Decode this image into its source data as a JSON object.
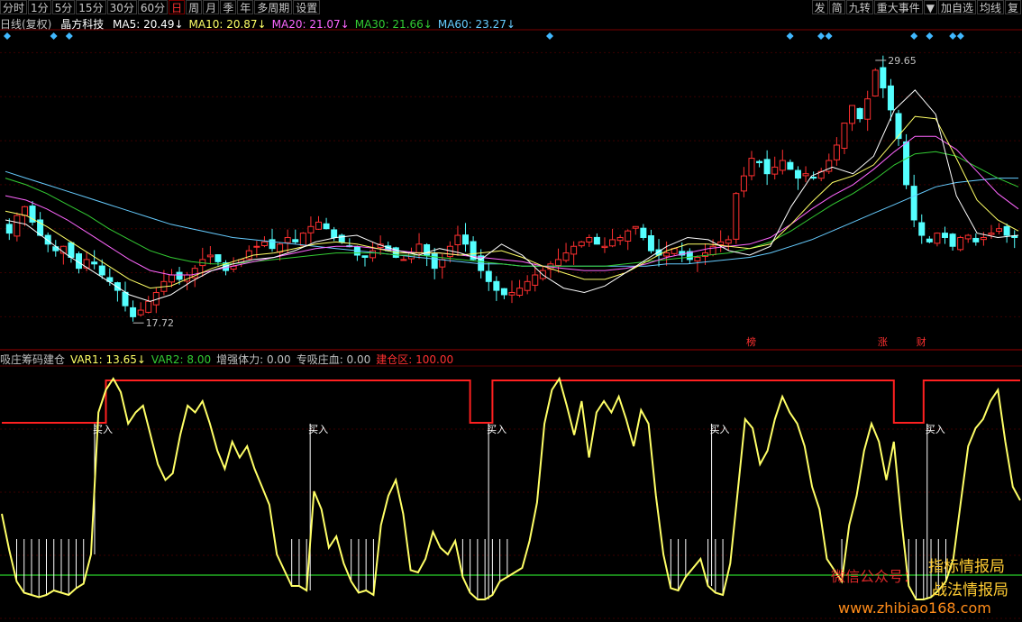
{
  "toolbar": {
    "left": [
      "分时",
      "1分",
      "5分",
      "15分",
      "30分",
      "60分",
      "日",
      "周",
      "月",
      "季",
      "年",
      "多周期",
      "设置"
    ],
    "active": "日",
    "right": [
      "发",
      "简",
      "九转",
      "重大事件",
      "▼",
      "加自选",
      "均线",
      "复"
    ]
  },
  "header": {
    "period": "日线(复权)",
    "stock": "晶方科技",
    "ma": [
      {
        "label": "MA5: 20.49↓",
        "color": "#ffffff"
      },
      {
        "label": "MA10: 20.87↓",
        "color": "#ffff66"
      },
      {
        "label": "MA20: 21.07↓",
        "color": "#ff66ff"
      },
      {
        "label": "MA30: 21.66↓",
        "color": "#33cc33"
      },
      {
        "label": "MA60: 23.27↓",
        "color": "#66ccff"
      }
    ]
  },
  "indicator_header": [
    {
      "label": "吸庄筹码建仓",
      "color": "#c0c0c0"
    },
    {
      "label": "VAR1: 13.65↓",
      "color": "#ffff66"
    },
    {
      "label": "VAR2: 8.00",
      "color": "#33cc33"
    },
    {
      "label": "增强体力: 0.00",
      "color": "#c0c0c0"
    },
    {
      "label": "专吸庄血: 0.00",
      "color": "#c0c0c0"
    },
    {
      "label": "建仓区: 100.00",
      "color": "#ff3030"
    }
  ],
  "chart_data": [
    {
      "type": "candlestick",
      "title": "",
      "colors": {
        "up": "#ff3030",
        "down": "#54ffff",
        "ma5": "#ffffff",
        "ma10": "#ffff66",
        "ma20": "#ff66ff",
        "ma30": "#33cc33",
        "ma60": "#66ccff"
      },
      "annotations": [
        {
          "text": "29.65",
          "kind": "high"
        },
        {
          "text": "17.72",
          "kind": "low"
        },
        {
          "text": "榜",
          "kind": "mark"
        },
        {
          "text": "涨",
          "kind": "mark"
        },
        {
          "text": "财",
          "kind": "mark"
        }
      ],
      "closes": [
        21.8,
        22.6,
        23.0,
        22.3,
        21.7,
        21.3,
        21.0,
        21.2,
        20.7,
        20.2,
        20.6,
        20.4,
        19.9,
        19.6,
        19.2,
        18.5,
        18.0,
        18.3,
        18.7,
        19.1,
        19.6,
        19.9,
        19.7,
        19.9,
        20.2,
        20.6,
        20.8,
        20.5,
        20.1,
        20.3,
        20.6,
        21.0,
        21.2,
        21.4,
        21.1,
        21.3,
        21.6,
        21.4,
        21.8,
        22.1,
        22.3,
        22.0,
        21.6,
        21.4,
        21.2,
        20.8,
        20.7,
        21.0,
        21.3,
        21.0,
        20.7,
        20.6,
        20.9,
        21.3,
        20.8,
        20.2,
        20.6,
        21.2,
        21.7,
        21.3,
        20.6,
        20.1,
        19.6,
        19.2,
        19.0,
        19.1,
        19.3,
        19.6,
        19.9,
        20.1,
        20.4,
        20.6,
        20.9,
        21.2,
        21.4,
        21.6,
        21.3,
        21.2,
        21.5,
        21.6,
        21.9,
        22.1,
        21.6,
        21.0,
        20.8,
        20.9,
        21.1,
        20.8,
        20.6,
        20.7,
        20.9,
        21.2,
        21.4,
        21.5,
        23.6,
        24.4,
        25.2,
        25.0,
        24.5,
        24.8,
        25.1,
        24.7,
        24.3,
        24.5,
        24.3,
        24.6,
        25.1,
        25.8,
        26.8,
        27.6,
        27.0,
        27.9,
        29.2,
        28.4,
        27.4,
        26.1,
        24.0,
        22.4,
        21.7,
        21.4,
        21.8,
        21.6,
        21.2,
        21.6,
        21.7,
        21.4,
        21.6,
        21.8,
        22.0,
        21.7,
        21.6
      ],
      "ma": {
        "ma5": [
          22.4,
          22.2,
          21.5,
          20.8,
          20.2,
          19.6,
          19.0,
          18.7,
          19.0,
          19.6,
          20.1,
          20.4,
          20.6,
          20.7,
          21.0,
          21.4,
          21.6,
          21.7,
          21.3,
          21.0,
          20.8,
          21.1,
          20.9,
          20.6,
          21.3,
          20.8,
          19.9,
          19.3,
          19.1,
          19.4,
          20.0,
          20.6,
          21.2,
          21.6,
          21.5,
          21.0,
          20.8,
          21.2,
          23.0,
          24.4,
          24.8,
          24.5,
          25.3,
          27.4,
          28.3,
          27.2,
          23.5,
          21.8,
          21.6,
          21.7
        ],
        "ma10": [
          22.8,
          22.6,
          22.1,
          21.5,
          20.9,
          20.3,
          19.7,
          19.3,
          19.4,
          19.8,
          20.2,
          20.5,
          20.8,
          20.9,
          21.1,
          21.3,
          21.4,
          21.3,
          21.1,
          20.9,
          20.9,
          20.9,
          20.8,
          20.9,
          21.0,
          20.7,
          20.3,
          20.0,
          19.7,
          19.7,
          20.0,
          20.5,
          21.0,
          21.3,
          21.3,
          21.2,
          21.1,
          21.3,
          22.2,
          23.2,
          24.1,
          24.4,
          24.9,
          26.0,
          27.1,
          27.0,
          25.2,
          23.3,
          22.4,
          21.9
        ],
        "ma20": [
          23.5,
          23.3,
          22.9,
          22.4,
          21.8,
          21.2,
          20.6,
          20.1,
          19.9,
          19.9,
          20.1,
          20.3,
          20.5,
          20.7,
          20.9,
          21.1,
          21.2,
          21.2,
          21.1,
          21.0,
          20.9,
          20.9,
          20.8,
          20.7,
          20.6,
          20.5,
          20.3,
          20.2,
          20.1,
          20.1,
          20.2,
          20.4,
          20.7,
          20.9,
          21.1,
          21.2,
          21.3,
          21.6,
          22.2,
          22.9,
          23.5,
          24.0,
          24.7,
          25.5,
          26.2,
          26.2,
          25.6,
          24.6,
          23.6,
          22.9
        ],
        "ma30": [
          24.3,
          24.0,
          23.6,
          23.1,
          22.6,
          22.0,
          21.5,
          21.0,
          20.7,
          20.5,
          20.4,
          20.4,
          20.5,
          20.6,
          20.7,
          20.8,
          20.9,
          20.9,
          20.9,
          20.8,
          20.8,
          20.7,
          20.6,
          20.5,
          20.4,
          20.3,
          20.3,
          20.3,
          20.3,
          20.3,
          20.4,
          20.5,
          20.6,
          20.7,
          20.8,
          20.9,
          21.1,
          21.4,
          21.9,
          22.5,
          23.1,
          23.6,
          24.2,
          24.9,
          25.4,
          25.5,
          25.3,
          24.8,
          24.3,
          23.9
        ],
        "ma60": [
          24.6,
          24.3,
          24.0,
          23.7,
          23.4,
          23.1,
          22.8,
          22.5,
          22.2,
          22.0,
          21.8,
          21.6,
          21.5,
          21.4,
          21.3,
          21.2,
          21.1,
          21.0,
          20.9,
          20.8,
          20.7,
          20.6,
          20.5,
          20.4,
          20.4,
          20.3,
          20.3,
          20.3,
          20.3,
          20.3,
          20.3,
          20.3,
          20.4,
          20.4,
          20.5,
          20.6,
          20.7,
          20.9,
          21.2,
          21.5,
          21.9,
          22.3,
          22.7,
          23.1,
          23.5,
          23.9,
          24.1,
          24.2,
          24.3,
          24.3
        ]
      }
    },
    {
      "type": "line",
      "title": "吸庄筹码建仓",
      "ylim": [
        0,
        100
      ],
      "series": [
        {
          "name": "VAR1",
          "color": "#ffff66",
          "values": [
            40,
            24,
            10,
            5,
            4,
            3,
            4,
            6,
            5,
            4,
            7,
            9,
            22,
            85,
            95,
            100,
            94,
            80,
            85,
            88,
            75,
            62,
            55,
            58,
            75,
            88,
            85,
            90,
            80,
            68,
            60,
            72,
            65,
            70,
            60,
            52,
            44,
            22,
            15,
            8,
            8,
            6,
            50,
            42,
            25,
            30,
            18,
            10,
            5,
            6,
            4,
            35,
            48,
            55,
            40,
            15,
            14,
            20,
            32,
            25,
            22,
            28,
            12,
            5,
            2,
            2,
            4,
            10,
            12,
            14,
            16,
            28,
            45,
            80,
            95,
            100,
            88,
            75,
            90,
            65,
            85,
            90,
            85,
            92,
            82,
            70,
            86,
            80,
            48,
            22,
            7,
            6,
            12,
            16,
            20,
            8,
            5,
            4,
            18,
            50,
            82,
            78,
            62,
            68,
            82,
            92,
            85,
            80,
            70,
            52,
            42,
            20,
            15,
            10,
            35,
            48,
            68,
            80,
            72,
            55,
            72,
            38,
            8,
            2,
            2,
            3,
            6,
            10,
            20,
            45,
            70,
            78,
            82,
            90,
            95,
            72,
            52,
            46
          ]
        }
      ],
      "buy_labels": [
        "买入",
        "买入",
        "买入",
        "买入",
        "买入"
      ]
    }
  ],
  "watermarks": [
    "微信公众号：",
    "指标情报局",
    "战法情报局",
    "www.zhibiao168.com"
  ]
}
